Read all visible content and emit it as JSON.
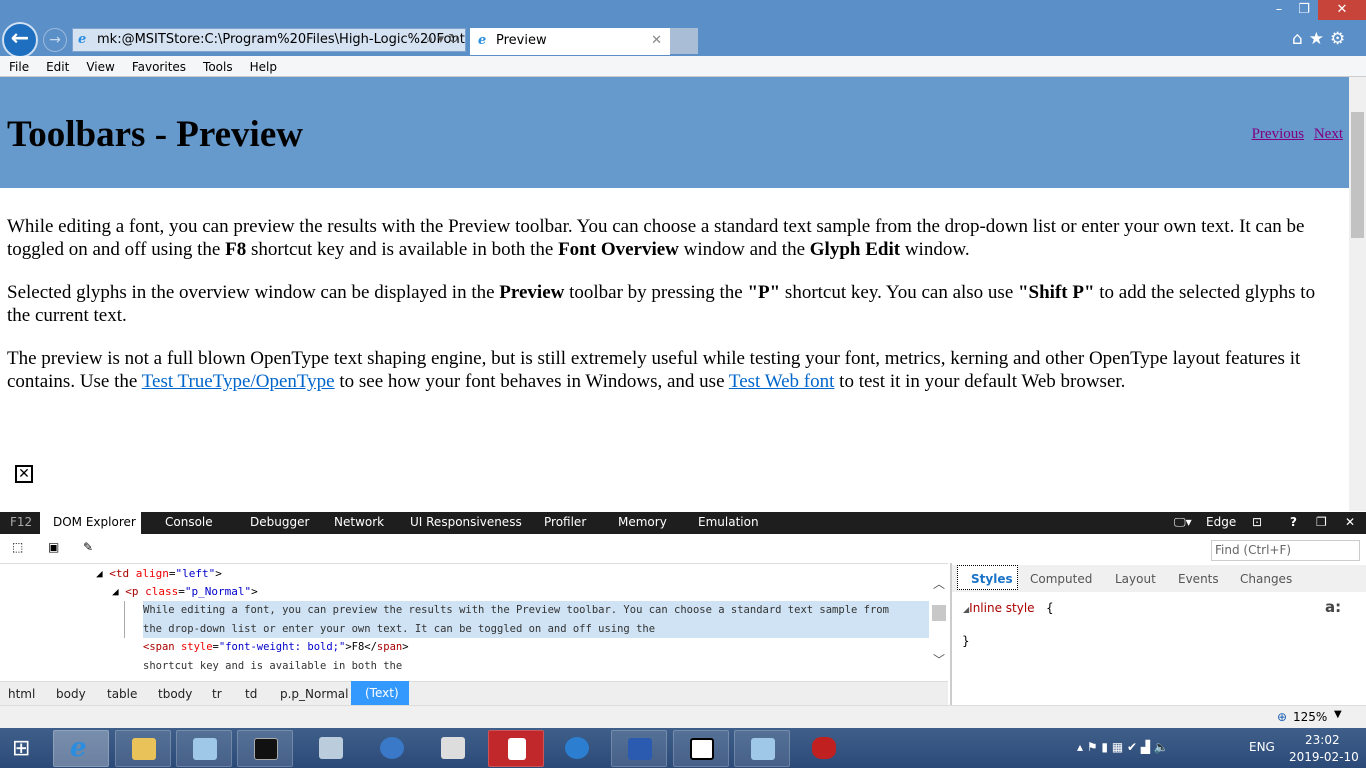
{
  "browser": {
    "address": "mk:@MSITStore:C:\\Program%20Files\\High-Logic%20FontC",
    "tab_title": "Preview",
    "menu": [
      "File",
      "Edit",
      "View",
      "Favorites",
      "Tools",
      "Help"
    ],
    "window_controls": {
      "minimize": "–",
      "maximize": "❐",
      "close": "✕"
    },
    "zoom": "125%"
  },
  "page": {
    "title": "Toolbars - Preview",
    "nav": {
      "previous": "Previous",
      "next": "Next"
    },
    "p1": {
      "a": "While editing a font, you can preview the results with the Preview toolbar. You can choose a standard text sample from the drop-down list or enter your own text. It can be toggled on and off using the ",
      "b1": "F8",
      "c": " shortcut key and is available in both the ",
      "b2": "Font Overview",
      "d": " window and the ",
      "b3": "Glyph Edit",
      "e": " window."
    },
    "p2": {
      "a": "Selected glyphs in the overview window can be displayed in the ",
      "b1": "Preview",
      "c": " toolbar by pressing the ",
      "b2": "\"P\"",
      "d": " shortcut key. You can also use ",
      "b3": "\"Shift P\"",
      "e": " to add the selected glyphs to the current text."
    },
    "p3": {
      "a": "The preview is not a full blown OpenType text shaping engine, but is still extremely useful while testing your font, metrics, kerning and other OpenType layout features it contains. Use the ",
      "l1": "Test TrueType/OpenType",
      "c": " to see how your font behaves in Windows, and use ",
      "l2": "Test Web font",
      "e": " to test it in your default Web browser."
    }
  },
  "devtools": {
    "f12": "F12",
    "tabs": [
      "DOM Explorer",
      "Console",
      "Debugger",
      "Network",
      "UI Responsiveness",
      "Profiler",
      "Memory",
      "Emulation"
    ],
    "mode": "Edge",
    "find_placeholder": "Find (Ctrl+F)",
    "dom": {
      "td_tag": "<td",
      "td_attr": "align",
      "td_val": "\"left\"",
      "close": ">",
      "p_tag": "<p",
      "p_attr": "class",
      "p_val": "\"p_Normal\"",
      "text1": "While editing a font, you can preview the results with the Preview toolbar. You can choose a standard text sample from",
      "text2": "the drop-down list or enter your own text. It can be toggled on and off using the",
      "span_tag": "<span",
      "span_attr": "style",
      "span_val": "\"font-weight: bold;\"",
      "span_text": ">F8</",
      "span_end": "span",
      "text3": "shortcut key and is available in both the"
    },
    "breadcrumbs": [
      "html",
      "body",
      "table",
      "tbody",
      "tr",
      "td",
      "p.p_Normal",
      "(Text)"
    ],
    "style_tabs": [
      "Styles",
      "Computed",
      "Layout",
      "Events",
      "Changes"
    ],
    "inline_style": "Inline style",
    "open_brace": "{",
    "close_brace": "}",
    "pseudo": "a:"
  },
  "taskbar": {
    "lang": "ENG",
    "time": "23:02",
    "date": "2019-02-10"
  }
}
